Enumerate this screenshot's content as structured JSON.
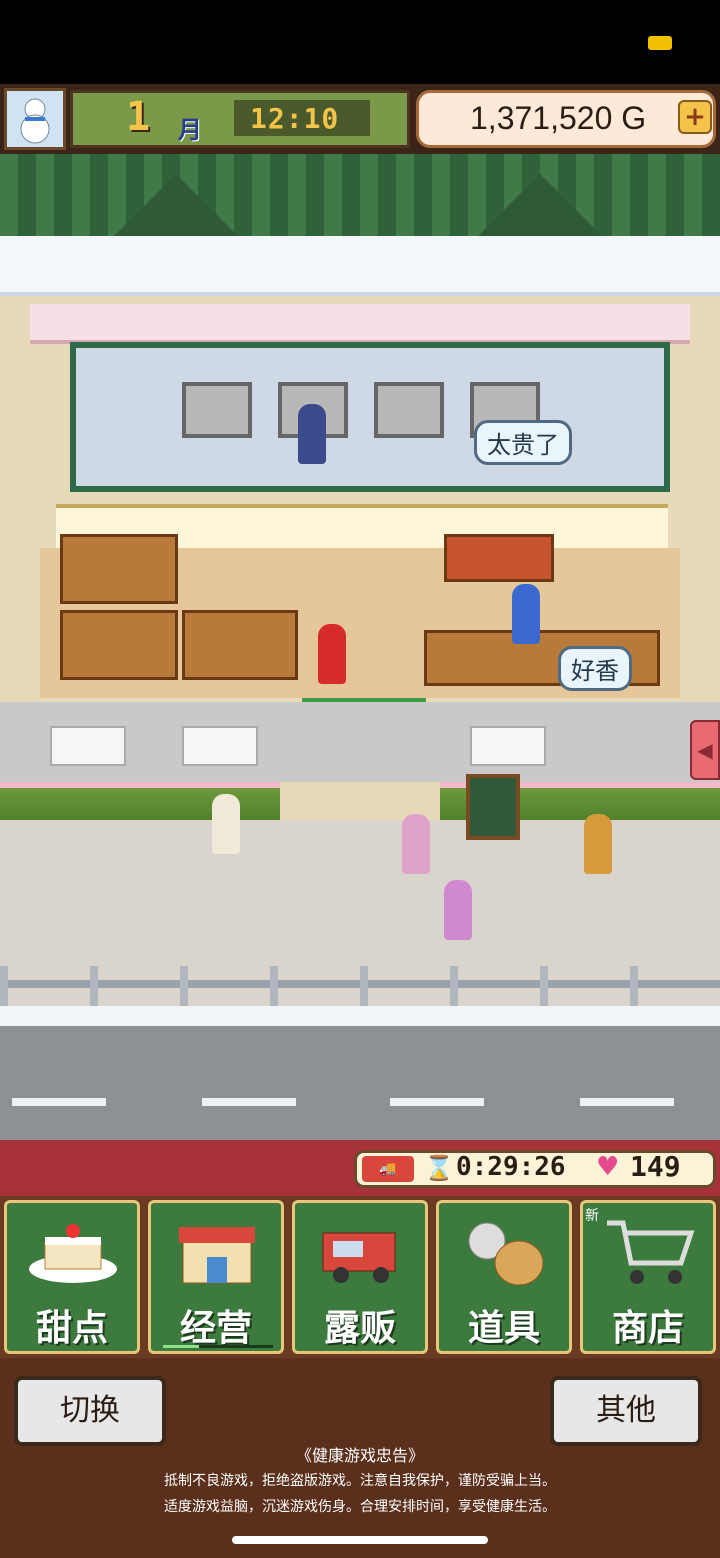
{
  "hud": {
    "month_number": "1",
    "month_label": "月",
    "time": "12:10",
    "money": "1,371,520 G",
    "plus": "+"
  },
  "scene": {
    "speech_1": "太贵了",
    "speech_2": "好香",
    "side_tab_icon": "◀"
  },
  "status": {
    "timer": "0:29:26",
    "hearts": "149",
    "truck_icon": "food-truck-icon",
    "hourglass_icon": "⌛",
    "heart_icon": "♥"
  },
  "menu": {
    "items": [
      {
        "label": "甜点",
        "icon": "cake-icon"
      },
      {
        "label": "经营",
        "icon": "shop-icon"
      },
      {
        "label": "露贩",
        "icon": "food-truck-icon"
      },
      {
        "label": "道具",
        "icon": "item-bag-icon"
      },
      {
        "label": "商店",
        "icon": "shopping-cart-icon",
        "badge": "新"
      }
    ]
  },
  "footer": {
    "switch_label": "切换",
    "other_label": "其他",
    "notice_title": "《健康游戏忠告》",
    "notice_line1": "抵制不良游戏，拒绝盗版游戏。注意自我保护，谨防受骗上当。",
    "notice_line2": "适度游戏益脑，沉迷游戏伤身。合理安排时间，享受健康生活。"
  },
  "colors": {
    "menu_green": "#3d7a3e",
    "bar_red": "#a8323a",
    "gold": "#f3c34a"
  }
}
